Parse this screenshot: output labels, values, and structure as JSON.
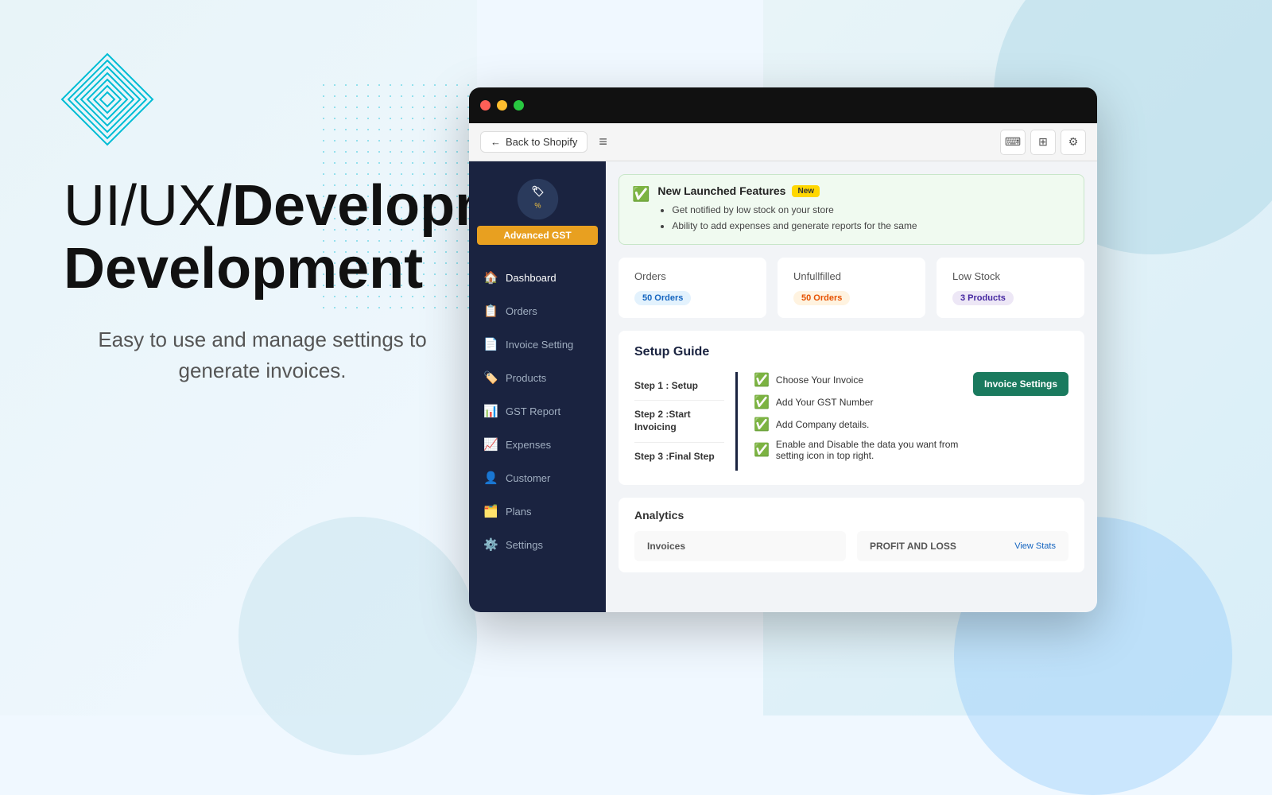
{
  "page": {
    "background": "#f0f8ff"
  },
  "hero": {
    "title_light": "UI/UX",
    "title_bold": "Development",
    "subtitle": "Easy to use and manage settings to generate invoices."
  },
  "toolbar": {
    "back_label": "Back to Shopify",
    "icons": [
      "keyboard-icon",
      "grid-icon",
      "settings-icon"
    ]
  },
  "sidebar": {
    "brand_name": "Advanced GST",
    "nav_items": [
      {
        "id": "dashboard",
        "label": "Dashboard",
        "icon": "🏠",
        "active": true
      },
      {
        "id": "orders",
        "label": "Orders",
        "icon": "📋",
        "active": false
      },
      {
        "id": "invoice-setting",
        "label": "Invoice Setting",
        "icon": "📄",
        "active": false
      },
      {
        "id": "products",
        "label": "Products",
        "icon": "🏷️",
        "active": false
      },
      {
        "id": "gst-report",
        "label": "GST Report",
        "icon": "📊",
        "active": false
      },
      {
        "id": "expenses",
        "label": "Expenses",
        "icon": "📈",
        "active": false
      },
      {
        "id": "customer",
        "label": "Customer",
        "icon": "👤",
        "active": false
      },
      {
        "id": "plans",
        "label": "Plans",
        "icon": "🗂️",
        "active": false
      },
      {
        "id": "settings",
        "label": "Settings",
        "icon": "⚙️",
        "active": false
      }
    ]
  },
  "feature_banner": {
    "title": "New Launched Features",
    "badge": "New",
    "bullets": [
      "Get notified by low stock on your store",
      "Ability to add expenses and generate reports for the same"
    ]
  },
  "stats": [
    {
      "label": "Orders",
      "badge_text": "50 Orders",
      "badge_type": "blue"
    },
    {
      "label": "Unfullfilled",
      "badge_text": "50 Orders",
      "badge_type": "orange"
    },
    {
      "label": "Low Stock",
      "badge_text": "3 Products",
      "badge_type": "purple"
    }
  ],
  "setup_guide": {
    "title": "Setup Guide",
    "steps": [
      {
        "label": "Step 1 : Setup",
        "items": [
          "Choose Your Invoice",
          "Add Your GST Number",
          "Add Company details."
        ],
        "action_label": "Invoice Settings"
      },
      {
        "label": "Step 2 :Start Invoicing",
        "items": [
          "Enable and Disable the data you want from setting icon in top right."
        ]
      },
      {
        "label": "Step 3 :Final Step",
        "items": []
      }
    ]
  },
  "analytics": {
    "title": "Analytics",
    "cards": [
      {
        "title": "Invoices",
        "link": null
      },
      {
        "title": "PROFIT AND LOSS",
        "link": "View Stats"
      }
    ]
  }
}
